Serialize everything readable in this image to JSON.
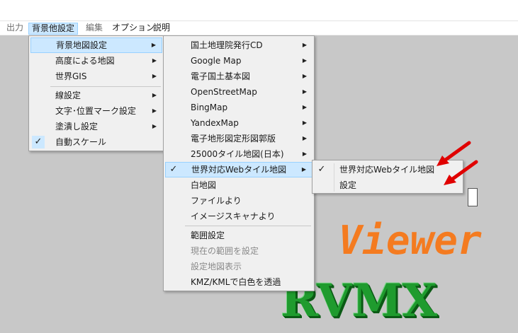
{
  "menubar": {
    "items": [
      {
        "label": "出力"
      },
      {
        "label": "背景他設定"
      },
      {
        "label": "編集"
      },
      {
        "label": "オプション"
      },
      {
        "label": "説明"
      }
    ]
  },
  "menu1": {
    "items": [
      {
        "label": "背景地図設定",
        "submenu": true
      },
      {
        "label": "高度による地図",
        "submenu": true
      },
      {
        "label": "世界GIS",
        "submenu": true
      },
      {
        "label": "線設定",
        "submenu": true
      },
      {
        "label": "文字･位置マーク設定",
        "submenu": true
      },
      {
        "label": "塗潰し設定",
        "submenu": true
      },
      {
        "label": "自動スケール",
        "checked": true
      }
    ]
  },
  "menu2": {
    "items": [
      {
        "label": "国土地理院発行CD",
        "submenu": true
      },
      {
        "label": "Google Map",
        "submenu": true
      },
      {
        "label": "電子国土基本図",
        "submenu": true
      },
      {
        "label": "OpenStreetMap",
        "submenu": true
      },
      {
        "label": "BingMap",
        "submenu": true
      },
      {
        "label": "YandexMap",
        "submenu": true
      },
      {
        "label": "電子地形図定形図郭版",
        "submenu": true
      },
      {
        "label": "25000タイル地図(日本)",
        "submenu": true
      },
      {
        "label": "世界対応Webタイル地図",
        "submenu": true,
        "checked": true
      },
      {
        "label": "白地図"
      },
      {
        "label": "ファイルより"
      },
      {
        "label": "イメージスキャナより"
      },
      {
        "label": "範囲設定"
      },
      {
        "label": "現在の範囲を設定",
        "disabled": true
      },
      {
        "label": "設定地図表示",
        "disabled": true
      },
      {
        "label": "KMZ/KMLで白色を透過"
      }
    ]
  },
  "menu3": {
    "items": [
      {
        "label": "世界対応Webタイル地図",
        "checked": true
      },
      {
        "label": "設定"
      }
    ]
  },
  "background": {
    "logo_text": "S Viewer",
    "logo_rvmx": "RVMX"
  },
  "glyphs": {
    "arrow": "▶",
    "check": "✓"
  },
  "colors": {
    "highlight": "#cce8ff",
    "highlight_border": "#99d1ff",
    "menu_bg": "#f0f0f0",
    "logo_orange": "#f47b20",
    "logo_green": "#1f9b2e",
    "annotation_arrow": "#e00000"
  }
}
